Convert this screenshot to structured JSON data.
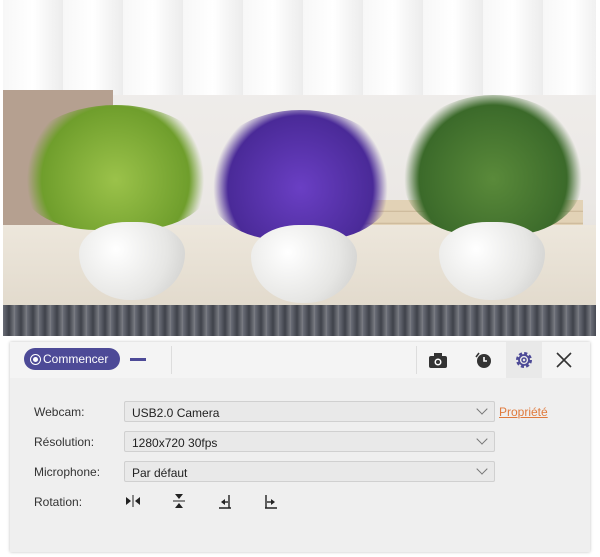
{
  "toolbar": {
    "start_label": "Commencer"
  },
  "settings": {
    "webcam": {
      "label": "Webcam:",
      "value": "USB2.0 Camera",
      "link": "Propriété"
    },
    "resolution": {
      "label": "Résolution:",
      "value": "1280x720 30fps"
    },
    "microphone": {
      "label": "Microphone:",
      "value": "Par défaut"
    },
    "rotation": {
      "label": "Rotation:"
    }
  },
  "colors": {
    "accent": "#4d4a97",
    "link": "#e07a3c"
  }
}
